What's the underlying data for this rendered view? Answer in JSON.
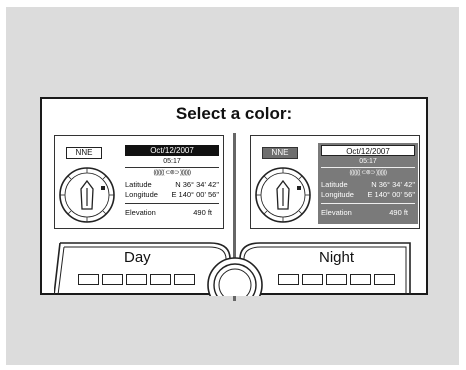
{
  "title": "Select a color:",
  "options": [
    {
      "label": "Day",
      "heading": "NNE",
      "date": "Oct/12/2007",
      "time": "05:17",
      "signal": "((((((( ⊂⊚⊃ )))))))",
      "latitude_label": "Latitude",
      "latitude": "N 36° 34' 42\"",
      "longitude_label": "Longitude",
      "longitude": "E 140° 00' 56\"",
      "elevation_label": "Elevation",
      "elevation": "490 ft"
    },
    {
      "label": "Night",
      "heading": "NNE",
      "date": "Oct/12/2007",
      "time": "05:17",
      "signal": "((((((( ⊂⊚⊃ )))))))",
      "latitude_label": "Latitude",
      "latitude": "N 36° 34' 42\"",
      "longitude_label": "Longitude",
      "longitude": "E 140° 00' 56\"",
      "elevation_label": "Elevation",
      "elevation": "490 ft"
    }
  ],
  "colors": {
    "background": "#dcdcdc",
    "night_panel": "#7a7a7a",
    "day_date_bar": "#111111"
  },
  "icons": [
    "compass-icon",
    "gps-signal-icon",
    "selector-dial-icon"
  ]
}
